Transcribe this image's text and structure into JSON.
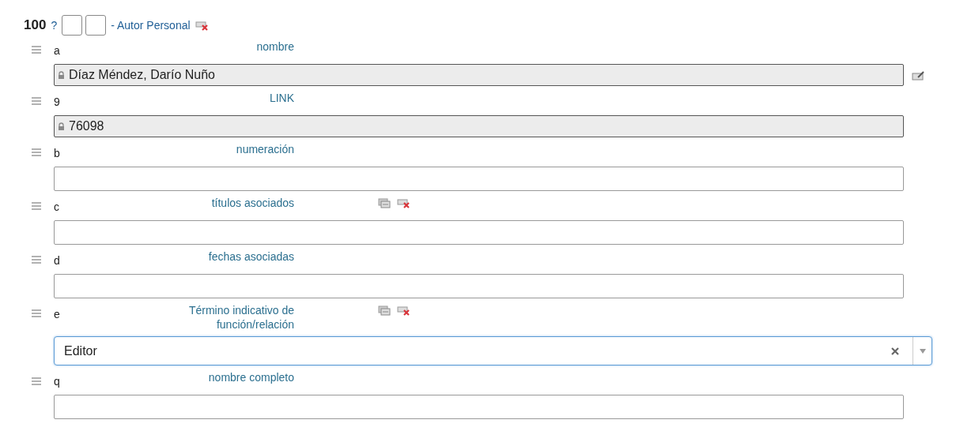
{
  "field": {
    "tag": "100",
    "help": "?",
    "indicators": [
      {
        "kind": "input"
      },
      {
        "kind": "input"
      }
    ],
    "title": "- Autor Personal"
  },
  "subfields": [
    {
      "code": "a",
      "label": "nombre",
      "kind": "locked",
      "value": "Díaz Méndez, Darío Nuño",
      "actions": false,
      "edit": true
    },
    {
      "code": "9",
      "label": "LINK",
      "kind": "locked",
      "value": "76098",
      "actions": false,
      "edit": false
    },
    {
      "code": "b",
      "label": "numeración",
      "kind": "text",
      "actions": false,
      "edit": false
    },
    {
      "code": "c",
      "label": "títulos asociados",
      "kind": "text",
      "actions": true,
      "edit": false
    },
    {
      "code": "d",
      "label": "fechas asociadas",
      "kind": "text",
      "actions": false,
      "edit": false
    },
    {
      "code": "e",
      "label": "Término indicativo de función/relación",
      "kind": "select",
      "value": "Editor",
      "actions": true,
      "edit": false
    },
    {
      "code": "q",
      "label": "nombre completo",
      "kind": "text",
      "actions": false,
      "edit": false
    }
  ]
}
